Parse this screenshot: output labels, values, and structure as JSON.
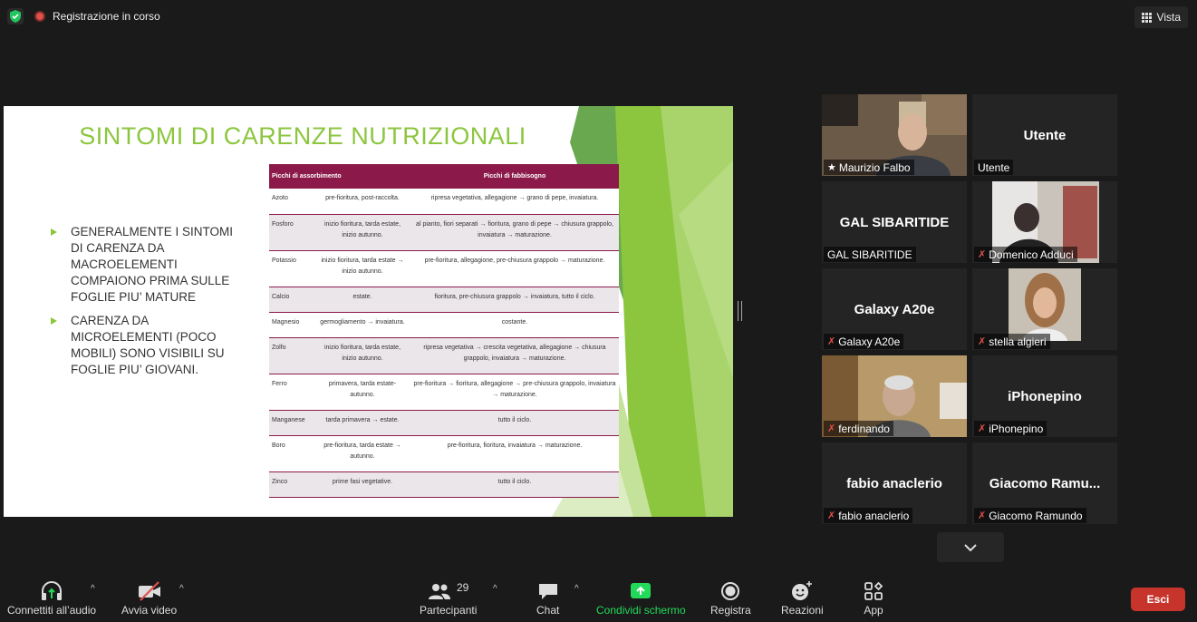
{
  "topbar": {
    "recording_label": "Registrazione in corso",
    "view_label": "Vista"
  },
  "slide": {
    "title": "SINTOMI DI CARENZE NUTRIZIONALI",
    "bullets": [
      "GENERALMENTE I SINTOMI DI CARENZA DA MACROELEMENTI COMPAIONO PRIMA SULLE FOGLIE PIU’ MATURE",
      "CARENZA DA MICROELEMENTI (POCO MOBILI) SONO VISIBILI SU FOGLIE PIU’ GIOVANI."
    ],
    "table": {
      "headers": [
        "Picchi di assorbimento",
        "Picchi di fabbisogno"
      ],
      "rows": [
        [
          "Azoto",
          "pre-fioritura, post-raccolta.",
          "ripresa vegetativa, allegagione → grano di pepe, invaiatura."
        ],
        [
          "Fosforo",
          "inizio fioritura, tarda estate, inizio autunno.",
          "al pianto, fiori separati → fioritura, grano di pepe → chiusura grappolo, invaiatura → maturazione."
        ],
        [
          "Potassio",
          "inizio fioritura, tarda estate → inizio autunno.",
          "pre-fioritura, allegagione, pre-chiusura grappolo → maturazione."
        ],
        [
          "Calcio",
          "estate.",
          "fioritura, pre-chiusura grappolo → invaiatura, tutto il ciclo."
        ],
        [
          "Magnesio",
          "germogliamento → invaiatura.",
          "costante."
        ],
        [
          "Zolfo",
          "inizio fioritura, tarda estate, inizio autunno.",
          "ripresa vegetativa → crescita vegetativa, allegagione → chiusura grappolo, invaiatura → maturazione."
        ],
        [
          "Ferro",
          "primavera, tarda estate-autunno.",
          "pre-fioritura → fioritura, allegagione → pre-chiusura grappolo, invaiatura → maturazione."
        ],
        [
          "Manganese",
          "tarda primavera → estate.",
          "tutto il ciclo."
        ],
        [
          "Boro",
          "pre-fioritura, tarda estate → autunno.",
          "pre-fioritura, fioritura, invaiatura → maturazione."
        ],
        [
          "Zinco",
          "prime fasi vegetative.",
          "tutto il ciclo."
        ]
      ]
    }
  },
  "participants": [
    {
      "name": "Maurizio Falbo",
      "center": "",
      "muted": false,
      "pinned": true
    },
    {
      "name": "Utente",
      "center": "Utente",
      "muted": false
    },
    {
      "name": "GAL SIBARITIDE",
      "center": "GAL SIBARITIDE",
      "muted": false
    },
    {
      "name": "Domenico Adduci",
      "center": "",
      "muted": true
    },
    {
      "name": "Galaxy A20e",
      "center": "Galaxy A20e",
      "muted": true
    },
    {
      "name": "stella algieri",
      "center": "",
      "muted": true
    },
    {
      "name": "ferdinando",
      "center": "",
      "muted": true
    },
    {
      "name": "iPhonepino",
      "center": "iPhonepino",
      "muted": true
    },
    {
      "name": "fabio anaclerio",
      "center": "fabio anaclerio",
      "muted": true
    },
    {
      "name": "Giacomo Ramundo",
      "center": "Giacomo  Ramu...",
      "muted": true
    }
  ],
  "toolbar": {
    "audio_label": "Connettiti all’audio",
    "video_label": "Avvia video",
    "participants_label": "Partecipanti",
    "participants_count": "29",
    "chat_label": "Chat",
    "share_label": "Condividi schermo",
    "record_label": "Registra",
    "reactions_label": "Reazioni",
    "apps_label": "App",
    "leave_label": "Esci"
  },
  "colors": {
    "accent_green": "#8cc63f",
    "table_header": "#8b1a4a",
    "share_green": "#23d959",
    "leave_red": "#c7342c",
    "active_speaker": "#ddf07a"
  }
}
